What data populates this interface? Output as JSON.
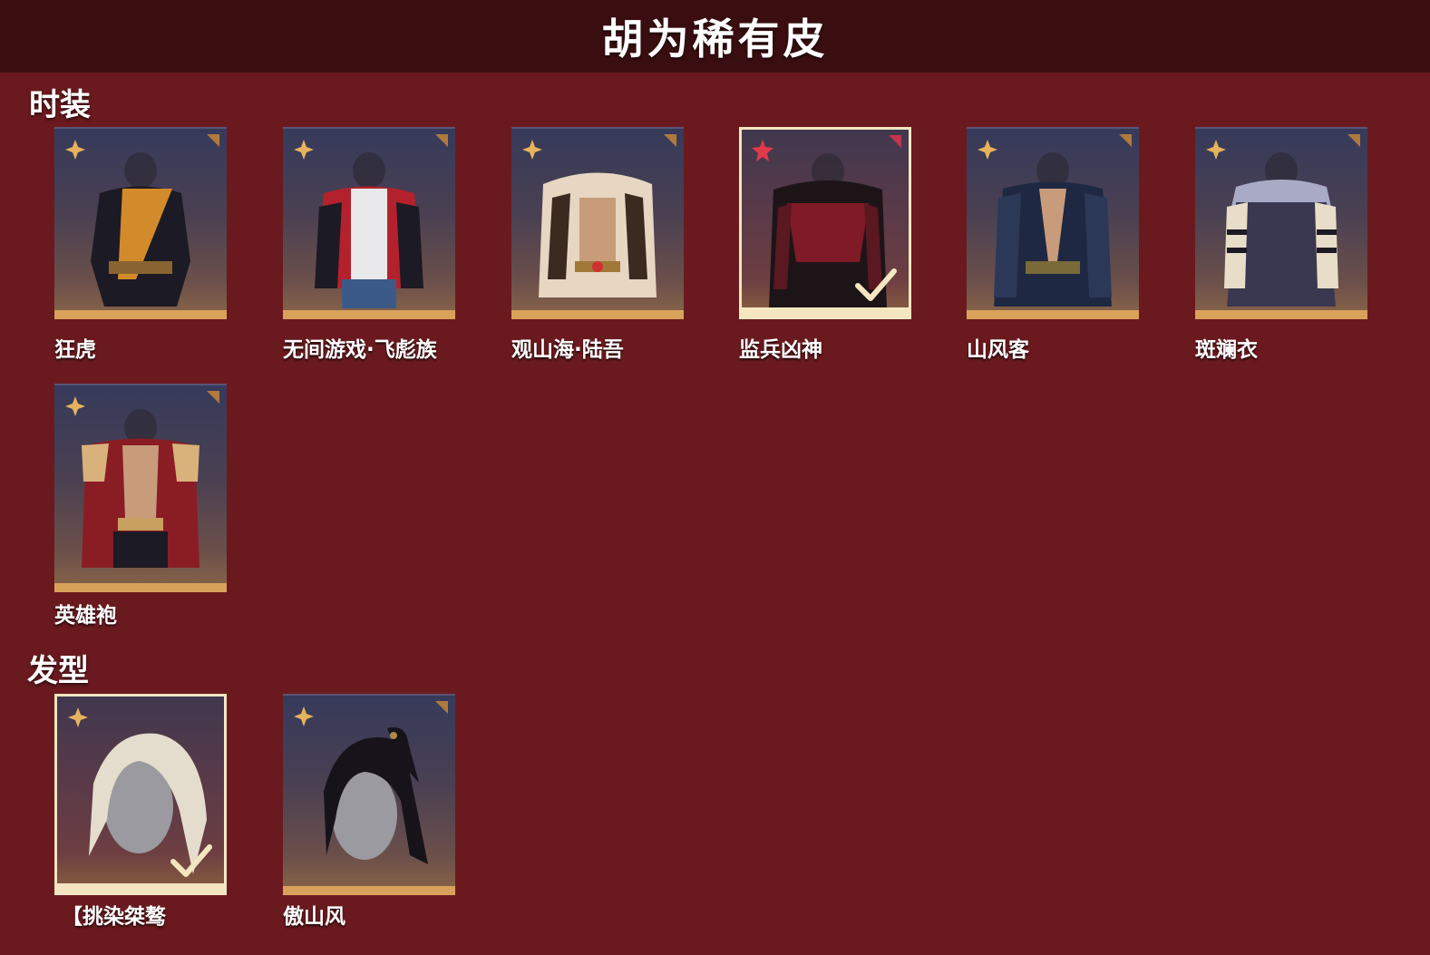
{
  "header": {
    "title": "胡为稀有皮"
  },
  "sections": {
    "fashion": {
      "title": "时装"
    },
    "hairstyle": {
      "title": "发型"
    }
  },
  "fashion_items": [
    {
      "name": "狂虎",
      "selected": false
    },
    {
      "name": "无间游戏·飞彪族",
      "selected": false
    },
    {
      "name": "观山海·陆吾",
      "selected": false
    },
    {
      "name": "监兵凶神",
      "selected": true
    },
    {
      "name": "山风客",
      "selected": false
    },
    {
      "name": "斑斓衣",
      "selected": false
    },
    {
      "name": "英雄袍",
      "selected": false
    }
  ],
  "hair_items": [
    {
      "name": "【挑染桀骜",
      "selected": true
    },
    {
      "name": "傲山风",
      "selected": false
    }
  ],
  "colors": {
    "background": "#6a1a1f",
    "header_bg": "#3a0e11",
    "rarity_gold": "#d9a25b",
    "rarity_red": "#e0394a",
    "selected_border": "#f3e6c0"
  }
}
